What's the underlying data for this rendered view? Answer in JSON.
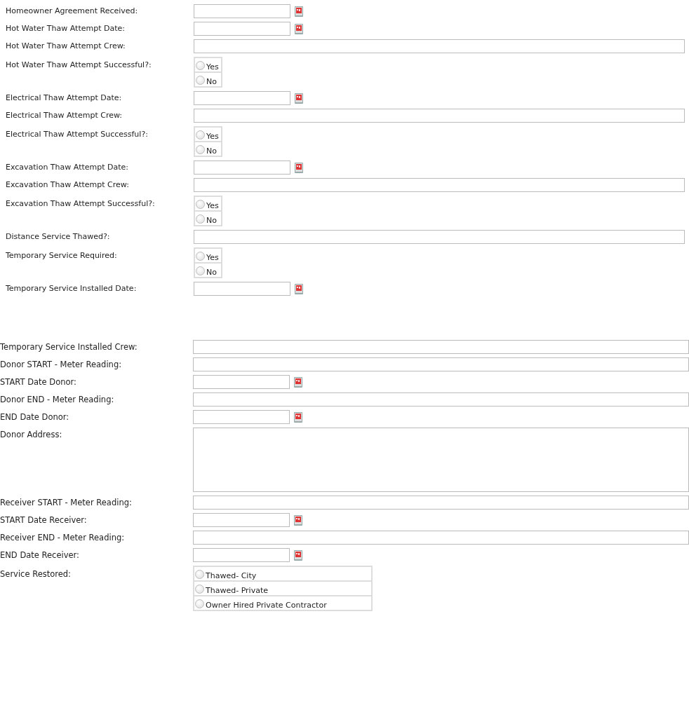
{
  "sections": [
    {
      "rows": [
        {
          "kind": "date",
          "label": "Homeowner Agreement Received:"
        },
        {
          "kind": "date",
          "label": "Hot Water Thaw Attempt Date:"
        },
        {
          "kind": "text",
          "label": "Hot Water Thaw Attempt Crew:"
        },
        {
          "kind": "radio",
          "label": "Hot Water Thaw Attempt Successful?:",
          "options": [
            {
              "label": "Yes",
              "selected": false
            },
            {
              "label": "No",
              "selected": false
            }
          ]
        },
        {
          "kind": "date",
          "label": "Electrical Thaw Attempt Date:"
        },
        {
          "kind": "text",
          "label": "Electrical Thaw Attempt Crew:"
        },
        {
          "kind": "radio",
          "label": "Electrical Thaw Attempt Successful?:",
          "options": [
            {
              "label": "Yes",
              "selected": false
            },
            {
              "label": "No",
              "selected": false
            }
          ]
        },
        {
          "kind": "date",
          "label": "Excavation Thaw Attempt Date:"
        },
        {
          "kind": "text",
          "label": "Excavation Thaw Attempt Crew:"
        },
        {
          "kind": "radio",
          "label": "Excavation Thaw Attempt Successful?:",
          "options": [
            {
              "label": "Yes",
              "selected": false
            },
            {
              "label": "No",
              "selected": false
            }
          ]
        },
        {
          "kind": "text",
          "label": "Distance Service Thawed?:"
        },
        {
          "kind": "radio",
          "label": "Temporary Service Required:",
          "options": [
            {
              "label": "Yes",
              "selected": false
            },
            {
              "label": "No",
              "selected": false
            }
          ]
        },
        {
          "kind": "date",
          "label": "Temporary Service Installed Date:"
        }
      ]
    },
    {
      "rows": [
        {
          "kind": "text",
          "label": "Temporary Service Installed Crew:"
        },
        {
          "kind": "text",
          "label": "Donor START - Meter Reading:"
        },
        {
          "kind": "date",
          "label": "START Date Donor:"
        },
        {
          "kind": "text",
          "label": "Donor END - Meter Reading:"
        },
        {
          "kind": "date",
          "label": "END Date Donor:"
        },
        {
          "kind": "textarea",
          "label": "Donor Address:"
        },
        {
          "kind": "text",
          "label": "Receiver START - Meter Reading:"
        },
        {
          "kind": "date",
          "label": "START Date Receiver:"
        },
        {
          "kind": "text",
          "label": "Receiver END - Meter Reading:"
        },
        {
          "kind": "date",
          "label": "END Date Receiver:"
        },
        {
          "kind": "radio",
          "label": "Service Restored:",
          "options": [
            {
              "label": "Thawed- City",
              "selected": false
            },
            {
              "label": "Thawed- Private",
              "selected": false
            },
            {
              "label": "Owner Hired Private Contractor",
              "selected": false
            }
          ]
        }
      ]
    }
  ]
}
